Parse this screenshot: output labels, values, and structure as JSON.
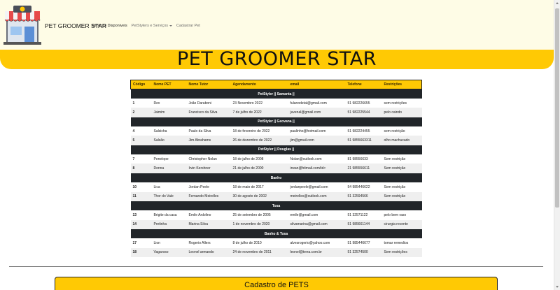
{
  "nav": {
    "brand": "PET GROOMER STAR",
    "links": [
      {
        "label": "Serviços Disponiveis"
      },
      {
        "label": "PetStylers e Serviços"
      },
      {
        "label": "Cadastrar Pet"
      }
    ]
  },
  "hero": {
    "title": "PET GROOMER STAR"
  },
  "table": {
    "headers": [
      "Código",
      "Nome PET",
      "Nome Tutor",
      "Agendamento",
      "email",
      "Telefone",
      "Restrições"
    ],
    "groups": [
      {
        "title": "PetStyler || Samanta ||",
        "rows": [
          [
            "1",
            "Rex",
            "João Daraboni",
            "23 Novembro 2022",
            "fulanodetal@gmail.com",
            "51 982226655",
            "sem restrições"
          ],
          [
            "2",
            "Jaimim",
            "Francisco da Silva",
            "7 de julho de 2022",
            "juvenal@gmail.com",
            "51 982225544",
            "pelo caindo"
          ]
        ]
      },
      {
        "title": "PetStyler || Geovana ||",
        "rows": [
          [
            "4",
            "Salsicha",
            "Paulo da Silva",
            "18 de fevereiro de 2022",
            "paulinho@hotmail.com",
            "51 982224455",
            "sem restrição"
          ],
          [
            "5",
            "Salsão",
            "Jim Abrahams",
            "26 de dezembro de 2022",
            "jim@gmail.com",
            "51 9855663311",
            "olho machucado"
          ]
        ]
      },
      {
        "title": "PetStyler || Douglas ||",
        "rows": [
          [
            "7",
            "Penelope",
            "Christopher Nolan",
            "18 de julho de 2008",
            "Nolan@outlook.com",
            "81 98556633",
            "Sem restrição"
          ],
          [
            "8",
            "Donna",
            "Irvin Kershner",
            "21 de julho de 2000",
            "irwan@hitmail.com/td>",
            "21 985556611",
            "Sem restrição"
          ]
        ]
      },
      {
        "title": "Banho",
        "rows": [
          [
            "10",
            "Lica",
            "Jordan Peele",
            "18 de maio de 2017",
            "jordanpeele@gmail.com",
            "54 985446622",
            "Sem restrição"
          ],
          [
            "11",
            "Thor do Vale",
            "Fernando Meirelles",
            "30 de agosto de 2002",
            "meirelles@outlook.com",
            "51 32594566",
            "Sem restrição"
          ]
        ]
      },
      {
        "title": "Tosa",
        "rows": [
          [
            "13",
            "Brigite da casa",
            "Emile Ardolino",
            "25 de setembro de 2005",
            "emile@gmail.com",
            "51 32571122",
            "pelo bem raso"
          ],
          [
            "14",
            "Pretinha",
            "Marina Silva",
            "1 de novembro de 2020",
            "silvamarina@gmail.com",
            "51 985661144",
            "cirurgia recente"
          ]
        ]
      },
      {
        "title": "Banho & Tosa",
        "rows": [
          [
            "17",
            "Lion",
            "Rogerio Allers",
            "8 de julho de 2010",
            "alvesrogerio@yahoo.com",
            "51 985446677",
            "tomar remedios"
          ],
          [
            "18",
            "Vagaroso",
            "Leonel armando",
            "24 de novembro de 2011",
            "leonel@terra.com.br",
            "51 32574500",
            "Sem restrições"
          ]
        ]
      }
    ]
  },
  "cadastro": {
    "title": "Cadastro de PETS"
  },
  "colors": {
    "accent": "#ffc904",
    "navbar_bg": "#fefce6",
    "group_bg": "#212529"
  }
}
